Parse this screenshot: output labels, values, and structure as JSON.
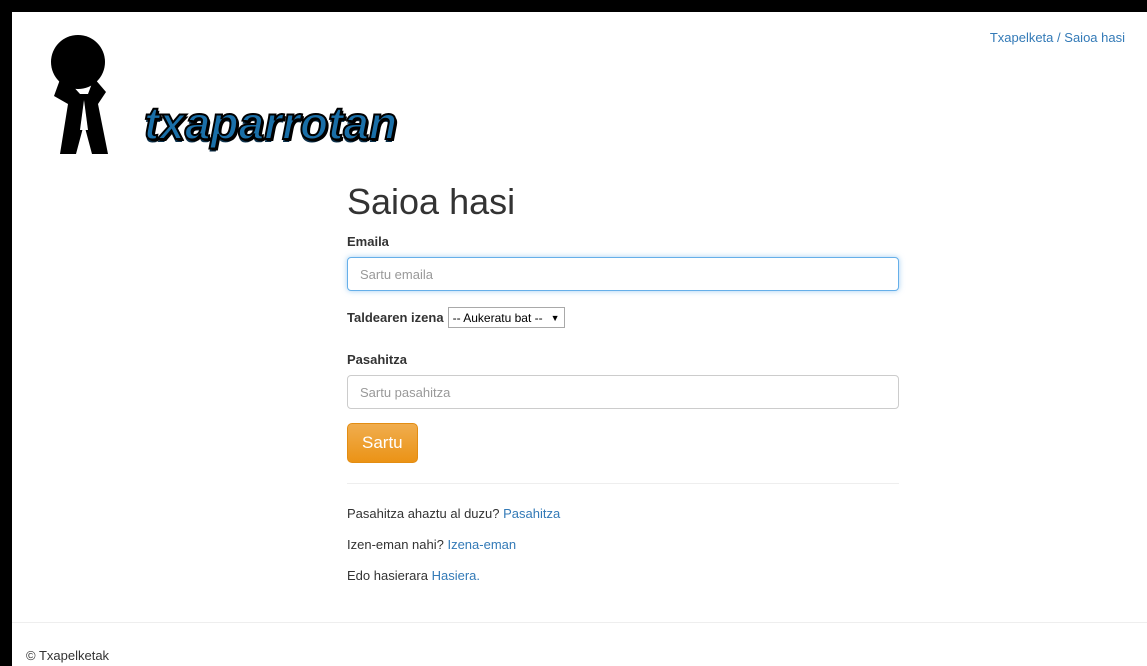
{
  "breadcrumb": {
    "parent": "Txapelketa",
    "separator": "/",
    "current": "Saioa hasi"
  },
  "logo": {
    "text": "txaparrotan",
    "icon": "person-lifting-ball-icon"
  },
  "form": {
    "title": "Saioa hasi",
    "email_label": "Emaila",
    "email_placeholder": "Sartu emaila",
    "email_value": "",
    "team_label": "Taldearen izena",
    "team_selected": "-- Aukeratu bat --",
    "password_label": "Pasahitza",
    "password_placeholder": "Sartu pasahitza",
    "submit_label": "Sartu"
  },
  "links": {
    "forgot_text": "Pasahitza ahaztu al duzu?",
    "forgot_link": "Pasahitza",
    "register_text": "Izen-eman nahi?",
    "register_link": "Izena-eman",
    "home_text": "Edo hasierara",
    "home_link": "Hasiera."
  },
  "footer": {
    "text": "© Txapelketak"
  },
  "colors": {
    "link": "#337ab7",
    "button": "#f0ad4e",
    "logo_blue": "#1a6fa8"
  }
}
